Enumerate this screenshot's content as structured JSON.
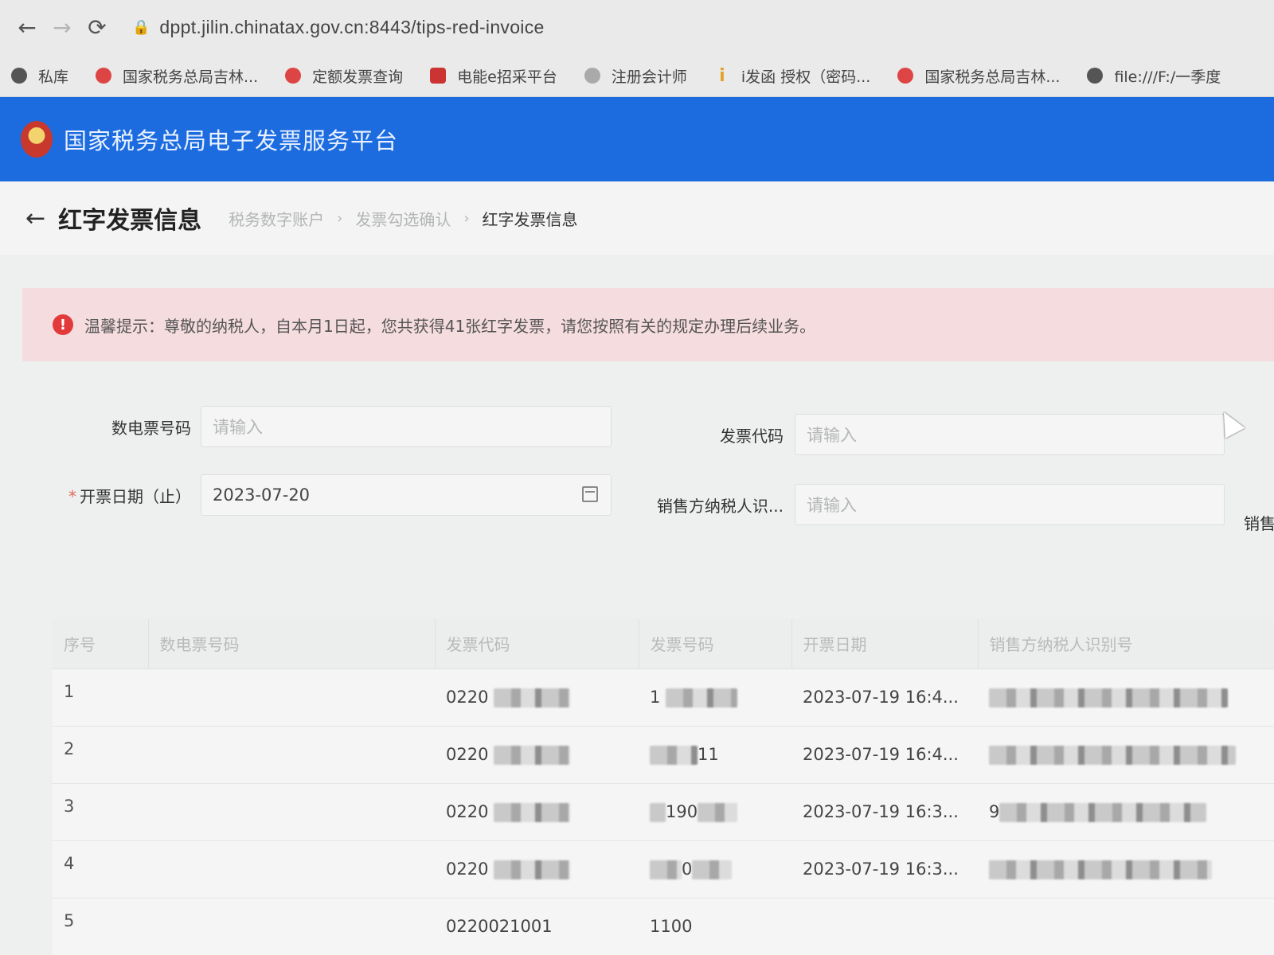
{
  "browser": {
    "url": "dppt.jilin.chinatax.gov.cn:8443/tips-red-invoice",
    "bookmarks": [
      {
        "label": "私库",
        "icon": "globe-icon"
      },
      {
        "label": "国家税务总局吉林...",
        "icon": "tax-emblem-icon"
      },
      {
        "label": "定额发票查询",
        "icon": "tax-emblem-icon"
      },
      {
        "label": "电能e招采平台",
        "icon": "power-icon"
      },
      {
        "label": "注册会计师",
        "icon": "cpa-icon"
      },
      {
        "label": "i发函 授权（密码...",
        "icon": "info-icon"
      },
      {
        "label": "国家税务总局吉林...",
        "icon": "tax-emblem-icon"
      },
      {
        "label": "file:///F:/一季度",
        "icon": "globe-icon"
      }
    ]
  },
  "header": {
    "site_title": "国家税务总局电子发票服务平台"
  },
  "page": {
    "title": "红字发票信息",
    "breadcrumb": [
      "税务数字账户",
      "发票勾选确认",
      "红字发票信息"
    ]
  },
  "alert": {
    "icon": "warning-icon",
    "text": "温馨提示：尊敬的纳税人，自本月1日起，您共获得41张红字发票，请您按照有关的规定办理后续业务。"
  },
  "form": {
    "digital_invoice_no": {
      "label": "数电票号码",
      "placeholder": "请输入"
    },
    "invoice_code": {
      "label": "发票代码",
      "placeholder": "请输入"
    },
    "issue_date_end": {
      "label": "开票日期（止）",
      "value": "2023-07-20",
      "required": true
    },
    "seller_tax_id": {
      "label": "销售方纳税人识...",
      "placeholder": "请输入"
    },
    "seller_next_label": "销售"
  },
  "table": {
    "headers": [
      "序号",
      "数电票号码",
      "发票代码",
      "发票号码",
      "开票日期",
      "销售方纳税人识别号"
    ],
    "rows": [
      {
        "seq": "1",
        "digital_no": "",
        "code": "0220",
        "number": "1",
        "date": "2023-07-19 16:4...",
        "seller_id": ""
      },
      {
        "seq": "2",
        "digital_no": "",
        "code": "0220",
        "number": "11",
        "date": "2023-07-19 16:4...",
        "seller_id": ""
      },
      {
        "seq": "3",
        "digital_no": "",
        "code": "0220",
        "number": "190",
        "date": "2023-07-19 16:3...",
        "seller_id": "9"
      },
      {
        "seq": "4",
        "digital_no": "",
        "code": "0220",
        "number": "0",
        "date": "2023-07-19 16:3...",
        "seller_id": ""
      },
      {
        "seq": "5",
        "digital_no": "",
        "code": "0220021001",
        "number": "1100",
        "date": "",
        "seller_id": ""
      }
    ]
  }
}
